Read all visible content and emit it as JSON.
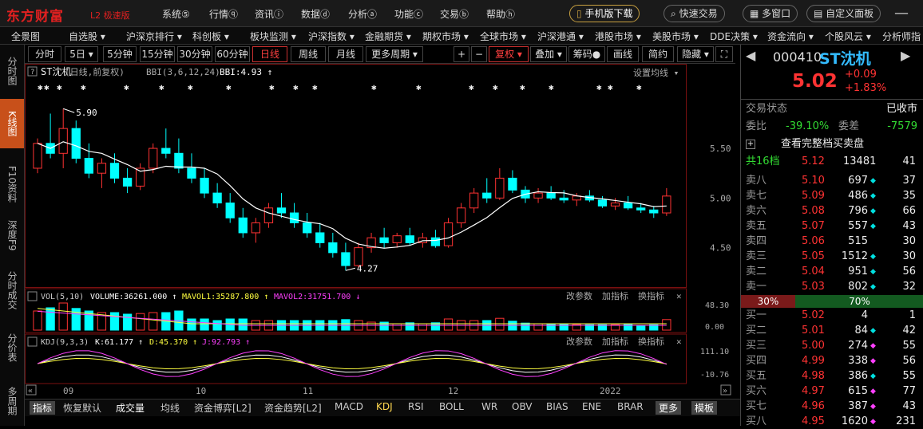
{
  "app": {
    "logo": "东方财富",
    "logo_sub": "L2 极速版"
  },
  "menu": [
    "系统⑤",
    "行情ⓠ",
    "资讯ⓘ",
    "数据ⓓ",
    "分析ⓐ",
    "功能ⓒ",
    "交易ⓑ",
    "帮助ⓗ"
  ],
  "top_buttons": {
    "mobile": "手机版下载",
    "quick_trade": "快速交易",
    "multi_window": "多窗口",
    "custom_panel": "自定义面板"
  },
  "nav": [
    "全景图",
    "自选股 ▾",
    "沪深京排行 ▾",
    "科创板 ▾",
    "板块监测 ▾",
    "沪深指数 ▾",
    "金融期货 ▾",
    "期权市场 ▾",
    "全球市场 ▾",
    "沪深港通 ▾",
    "港股市场 ▾",
    "美股市场 ▾",
    "DDE决策 ▾",
    "资金流向 ▾",
    "个股风云 ▾",
    "分析师指"
  ],
  "leftbar": [
    "分时图",
    "K线图",
    "F10资料",
    "深度F9",
    "分时成交",
    "分价表",
    "多周期"
  ],
  "toolbar": {
    "periods": [
      "分时",
      "5日 ▾",
      "5分钟",
      "15分钟",
      "30分钟",
      "60分钟",
      "日线",
      "周线",
      "月线",
      "更多周期 ▾"
    ],
    "right": [
      "+",
      "−",
      "复权 ▾",
      "叠加 ▾",
      "筹码●",
      "画线",
      "简约",
      "隐藏 ▾",
      "⛶"
    ]
  },
  "chart": {
    "title": "ST沈机",
    "subtitle": "(日线,前复权)",
    "bbi_label": "BBI(3,6,12,24)",
    "bbi_value": "BBI:4.93 ↑",
    "settings": "设置均线 ▾",
    "price_ticks": [
      "5.50",
      "5.00",
      "4.50"
    ],
    "high_label": "5.90",
    "low_label": "4.27",
    "vol_label": "VOL(5,10)",
    "volume": "VOLUME:36261.000 ↑",
    "mavol1": "MAVOL1:35287.800 ↑",
    "mavol2": "MAVOL2:31751.700 ↓",
    "vol_ticks": [
      "48.30",
      "0.00"
    ],
    "kdj_label": "KDJ(9,3,3)",
    "k": "K:61.177 ↑",
    "d": "D:45.370 ↑",
    "j": "J:92.793 ↑",
    "kdj_ticks": [
      "111.10",
      "-10.76"
    ],
    "panel_actions": [
      "改参数",
      "加指标",
      "换指标"
    ],
    "x_labels": [
      "09",
      "10",
      "11",
      "12",
      "2022"
    ]
  },
  "bottom_tabs": [
    "指标",
    "恢复默认",
    "成交量",
    "均线",
    "资金博弈[L2]",
    "资金趋势[L2]",
    "MACD",
    "KDJ",
    "RSI",
    "BOLL",
    "WR",
    "OBV",
    "BIAS",
    "ENE",
    "BRAR",
    "更多",
    "模板"
  ],
  "quote": {
    "code": "000410",
    "name": "ST沈机",
    "price": "5.02",
    "change": "+0.09",
    "pct": "+1.83%",
    "status_label": "交易状态",
    "status": "已收市",
    "wb_label": "委比",
    "wb": "-39.10%",
    "wc_label": "委差",
    "wc": "-7579",
    "full_book": "查看完整档买卖盘",
    "total_label": "共16档",
    "total_price": "5.12",
    "total_vol": "13481",
    "total_n": "41",
    "asks": [
      {
        "l": "卖八",
        "p": "5.10",
        "v": "697",
        "m": "◆",
        "n": "37"
      },
      {
        "l": "卖七",
        "p": "5.09",
        "v": "486",
        "m": "◆",
        "n": "35"
      },
      {
        "l": "卖六",
        "p": "5.08",
        "v": "796",
        "m": "◆",
        "n": "66"
      },
      {
        "l": "卖五",
        "p": "5.07",
        "v": "557",
        "m": "◆",
        "n": "43"
      },
      {
        "l": "卖四",
        "p": "5.06",
        "v": "515",
        "m": "",
        "n": "30"
      },
      {
        "l": "卖三",
        "p": "5.05",
        "v": "1512",
        "m": "◆",
        "n": "30"
      },
      {
        "l": "卖二",
        "p": "5.04",
        "v": "951",
        "m": "◆",
        "n": "56"
      },
      {
        "l": "卖一",
        "p": "5.03",
        "v": "802",
        "m": "◆",
        "n": "32"
      }
    ],
    "ratio_left": "30%",
    "ratio_right": "70%",
    "bids": [
      {
        "l": "买一",
        "p": "5.02",
        "v": "4",
        "m": "",
        "n": "1"
      },
      {
        "l": "买二",
        "p": "5.01",
        "v": "84",
        "m": "◆",
        "n": "42"
      },
      {
        "l": "买三",
        "p": "5.00",
        "v": "274",
        "m": "◆",
        "n": "55"
      },
      {
        "l": "买四",
        "p": "4.99",
        "v": "338",
        "m": "◆",
        "n": "56"
      },
      {
        "l": "买五",
        "p": "4.98",
        "v": "386",
        "m": "◆",
        "n": "55"
      },
      {
        "l": "买六",
        "p": "4.97",
        "v": "615",
        "m": "◆",
        "n": "77"
      },
      {
        "l": "买七",
        "p": "4.96",
        "v": "387",
        "m": "◆",
        "n": "43"
      },
      {
        "l": "买八",
        "p": "4.95",
        "v": "1620",
        "m": "◆",
        "n": "231"
      }
    ]
  },
  "chart_data": {
    "type": "candlestick",
    "ticker": "000410 ST沈机",
    "period": "日线",
    "price_range": [
      4.2,
      5.95
    ],
    "ohlc": [
      [
        5.3,
        5.6,
        5.25,
        5.55
      ],
      [
        5.55,
        5.85,
        5.4,
        5.45
      ],
      [
        5.45,
        5.9,
        5.3,
        5.7
      ],
      [
        5.7,
        5.78,
        5.35,
        5.4
      ],
      [
        5.4,
        5.55,
        5.2,
        5.25
      ],
      [
        5.25,
        5.4,
        5.1,
        5.35
      ],
      [
        5.35,
        5.45,
        5.15,
        5.2
      ],
      [
        5.2,
        5.3,
        5.05,
        5.12
      ],
      [
        5.12,
        5.35,
        5.08,
        5.3
      ],
      [
        5.3,
        5.55,
        5.25,
        5.5
      ],
      [
        5.5,
        5.7,
        5.4,
        5.45
      ],
      [
        5.45,
        5.6,
        5.25,
        5.3
      ],
      [
        5.3,
        5.45,
        5.15,
        5.2
      ],
      [
        5.2,
        5.3,
        5.0,
        5.05
      ],
      [
        5.05,
        5.15,
        4.9,
        4.95
      ],
      [
        4.95,
        5.05,
        4.75,
        4.8
      ],
      [
        4.8,
        4.9,
        4.6,
        4.65
      ],
      [
        4.65,
        4.8,
        4.55,
        4.75
      ],
      [
        4.75,
        4.95,
        4.7,
        4.9
      ],
      [
        4.9,
        5.05,
        4.8,
        4.85
      ],
      [
        4.85,
        4.95,
        4.7,
        4.75
      ],
      [
        4.75,
        4.85,
        4.6,
        4.65
      ],
      [
        4.65,
        4.75,
        4.5,
        4.55
      ],
      [
        4.55,
        4.65,
        4.4,
        4.45
      ],
      [
        4.45,
        4.55,
        4.27,
        4.32
      ],
      [
        4.32,
        4.55,
        4.3,
        4.5
      ],
      [
        4.5,
        4.65,
        4.45,
        4.6
      ],
      [
        4.6,
        4.7,
        4.5,
        4.55
      ],
      [
        4.55,
        4.65,
        4.5,
        4.62
      ],
      [
        4.62,
        4.7,
        4.52,
        4.55
      ],
      [
        4.55,
        4.65,
        4.5,
        4.6
      ],
      [
        4.6,
        4.68,
        4.5,
        4.52
      ],
      [
        4.52,
        4.8,
        4.5,
        4.75
      ],
      [
        4.75,
        4.95,
        4.7,
        4.9
      ],
      [
        4.9,
        5.1,
        4.85,
        5.05
      ],
      [
        5.05,
        5.2,
        4.95,
        5.0
      ],
      [
        5.0,
        5.3,
        4.98,
        5.2
      ],
      [
        5.2,
        5.28,
        5.05,
        5.08
      ],
      [
        5.08,
        5.12,
        4.95,
        5.0
      ],
      [
        5.0,
        5.1,
        4.95,
        5.05
      ],
      [
        5.05,
        5.12,
        4.98,
        5.0
      ],
      [
        5.0,
        5.08,
        4.95,
        4.98
      ],
      [
        4.98,
        5.05,
        4.92,
        5.02
      ],
      [
        5.02,
        5.08,
        4.96,
        4.98
      ],
      [
        4.98,
        5.02,
        4.9,
        4.92
      ],
      [
        4.92,
        5.0,
        4.88,
        4.95
      ],
      [
        4.95,
        5.02,
        4.88,
        4.9
      ],
      [
        4.9,
        4.95,
        4.85,
        4.88
      ],
      [
        4.88,
        4.92,
        4.8,
        4.85
      ],
      [
        4.85,
        5.1,
        4.82,
        5.02
      ]
    ],
    "bbi_last": 4.93,
    "volume_range": [
      0,
      48.3
    ],
    "kdj_range": [
      -10.76,
      111.1
    ],
    "kdj_last": {
      "K": 61.177,
      "D": 45.37,
      "J": 92.793
    }
  }
}
